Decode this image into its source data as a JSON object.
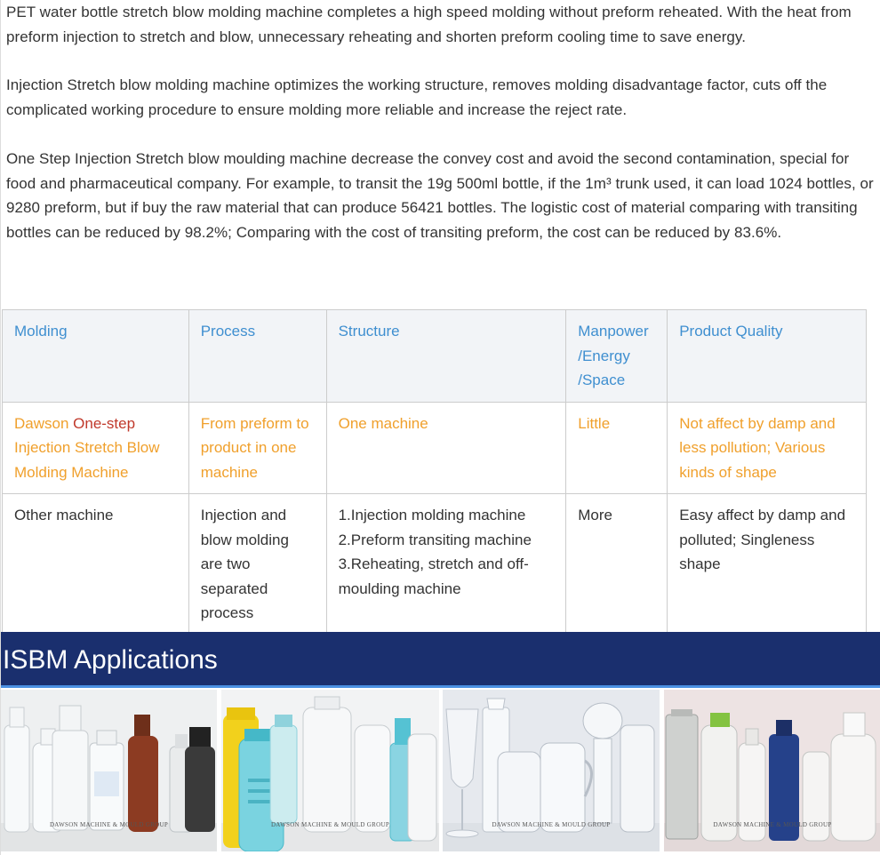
{
  "paragraphs": [
    "PET water bottle stretch blow molding machine completes a high speed molding without preform reheated. With the heat from preform injection to stretch and blow, unnecessary reheating and shorten preform cooling time to save energy.",
    "Injection Stretch blow molding machine optimizes the working structure, removes molding disadvantage factor, cuts off the complicated working procedure to ensure molding more reliable and increase the reject rate.",
    "One Step Injection Stretch blow moulding machine decrease the convey cost and avoid the second contamination, special for food and pharmaceutical company. For example, to transit the 19g 500ml bottle, if the 1m³ trunk used, it can load 1024 bottles, or 9280 preform, but if buy the raw material that can produce 56421 bottles. The logistic cost of material comparing with transiting bottles can be reduced by 98.2%; Comparing with the cost of transiting preform, the cost can be reduced by 83.6%."
  ],
  "table": {
    "headers": [
      "Molding",
      "Process",
      "Structure",
      "Manpower /Energy /Space",
      "Product Quality"
    ],
    "dawson": {
      "molding_prefix": "Dawson ",
      "molding_highlight": "One-step",
      "molding_rest": " Injection Stretch Blow Molding Machine",
      "process": "From preform to product in one machine",
      "structure": "One machine",
      "manpower": "Little",
      "quality": "Not affect by damp and less pollution; Various kinds of shape"
    },
    "other": {
      "molding": "Other machine",
      "process": "Injection and blow molding are two separated process",
      "structure_lines": [
        "1.Injection molding machine",
        "2.Preform transiting machine",
        "3.Reheating, stretch and off-moulding machine"
      ],
      "manpower": "More",
      "quality": "Easy affect by damp and polluted; Singleness shape"
    }
  },
  "section_title": "ISBM Applications",
  "gallery": [
    {
      "watermark": "DAWSON MACHINE & MOULD GROUP"
    },
    {
      "watermark": "DAWSON MACHINE & MOULD GROUP"
    },
    {
      "watermark": "DAWSON MACHINE & MOULD GROUP"
    },
    {
      "watermark": "DAWSON MACHINE & MOULD GROUP"
    }
  ],
  "colors": {
    "header_text": "#3f8fd0",
    "dawson_text": "#f0a02c",
    "highlight": "#c0392b",
    "banner_bg": "#1a2f6e",
    "banner_border": "#4a90e2"
  }
}
